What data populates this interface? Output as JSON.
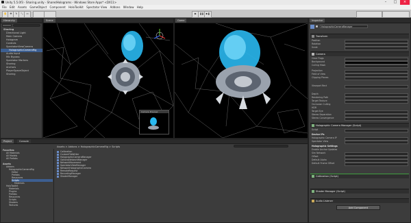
{
  "window": {
    "title": "Unity 5.5.0f3 - Sharing.unity - SharedHolograms - Windows Store Apps* <DX11>"
  },
  "menu": [
    "File",
    "Edit",
    "Assets",
    "GameObject",
    "Component",
    "HoloToolkit",
    "Spectator View",
    "Addons",
    "Window",
    "Help"
  ],
  "colors": {
    "accent": "#3d5f91",
    "hologram": "#29b8f0",
    "viewport": "#000000"
  },
  "hierarchy": {
    "tab": "Hierarchy",
    "items": [
      {
        "label": "Sharing"
      },
      {
        "label": "Directional Light"
      },
      {
        "label": "Main Camera"
      },
      {
        "label": "Hologram"
      },
      {
        "label": "Controls"
      },
      {
        "label": "SpectatorViewCamera"
      },
      {
        "label": "HolographicCameraRig",
        "selected": true
      },
      {
        "label": "Audio Input"
      },
      {
        "label": "Mic Bypass"
      },
      {
        "label": "Spectator Markers"
      },
      {
        "label": "Sharing"
      },
      {
        "label": "Anchors"
      },
      {
        "label": "PlayerSpaceObject"
      },
      {
        "label": "Sharing"
      }
    ]
  },
  "scene": {
    "tab_scene": "Scene",
    "tab_game": "Game",
    "preview_title": "Camera Preview"
  },
  "project": {
    "tabs": [
      "Project",
      "Console"
    ],
    "breadcrumb": "Assets > Addons > HolographicCameraRig > Scripts",
    "tree": [
      "Favorites",
      "All Materials",
      "All Models",
      "All Prefabs",
      "Assets",
      "Addons",
      "HolographicCameraRig",
      "Editor",
      "Prefabs",
      "Resources",
      "Scripts",
      "Materials",
      "HoloToolkit",
      "Materials",
      "Plugins",
      "Prefabs",
      "Resources",
      "Scripts",
      "Shaders",
      "Textures"
    ],
    "files": [
      "Calibration",
      "CustomFileWriter",
      "HolographicCameraManager",
      "OptionsNetworkManager",
      "NetworkMovement",
      "SpectatorViewManager",
      "NetworkHolographicCamera",
      "RemoteRequest",
      "RecordingManager",
      "ShaderManager"
    ]
  },
  "inspector": {
    "tab": "Inspector",
    "object_name": "HolographicCameraManager",
    "transform_label": "Transform",
    "transform_rows": [
      "Position",
      "Rotation",
      "Scale"
    ],
    "camera_label": "Camera",
    "camera_rows": [
      "Clear Flags",
      "Background",
      "Culling Mask",
      "Projection",
      "Field of View",
      "Clipping Planes",
      "Viewport Rect",
      "Depth",
      "Rendering Path",
      "Target Texture",
      "Occlusion Culling",
      "HDR",
      "Target Eye",
      "Stereo Separation",
      "Stereo Convergence"
    ],
    "script_label": "Holographic Camera Manager (Script)",
    "script_rows": [
      "Script",
      "Device IPs",
      "Holographic Camera IP",
      "Spectator View",
      "Holographic Settings",
      "Enable Anchor Updates",
      "Sim Network",
      "Offset",
      "Default Alpha",
      "Default Frame Offset"
    ],
    "components": [
      "Calibration (Script)",
      "Shader Manager (Script)",
      "Audio Listener"
    ],
    "add_component": "Add Component"
  }
}
